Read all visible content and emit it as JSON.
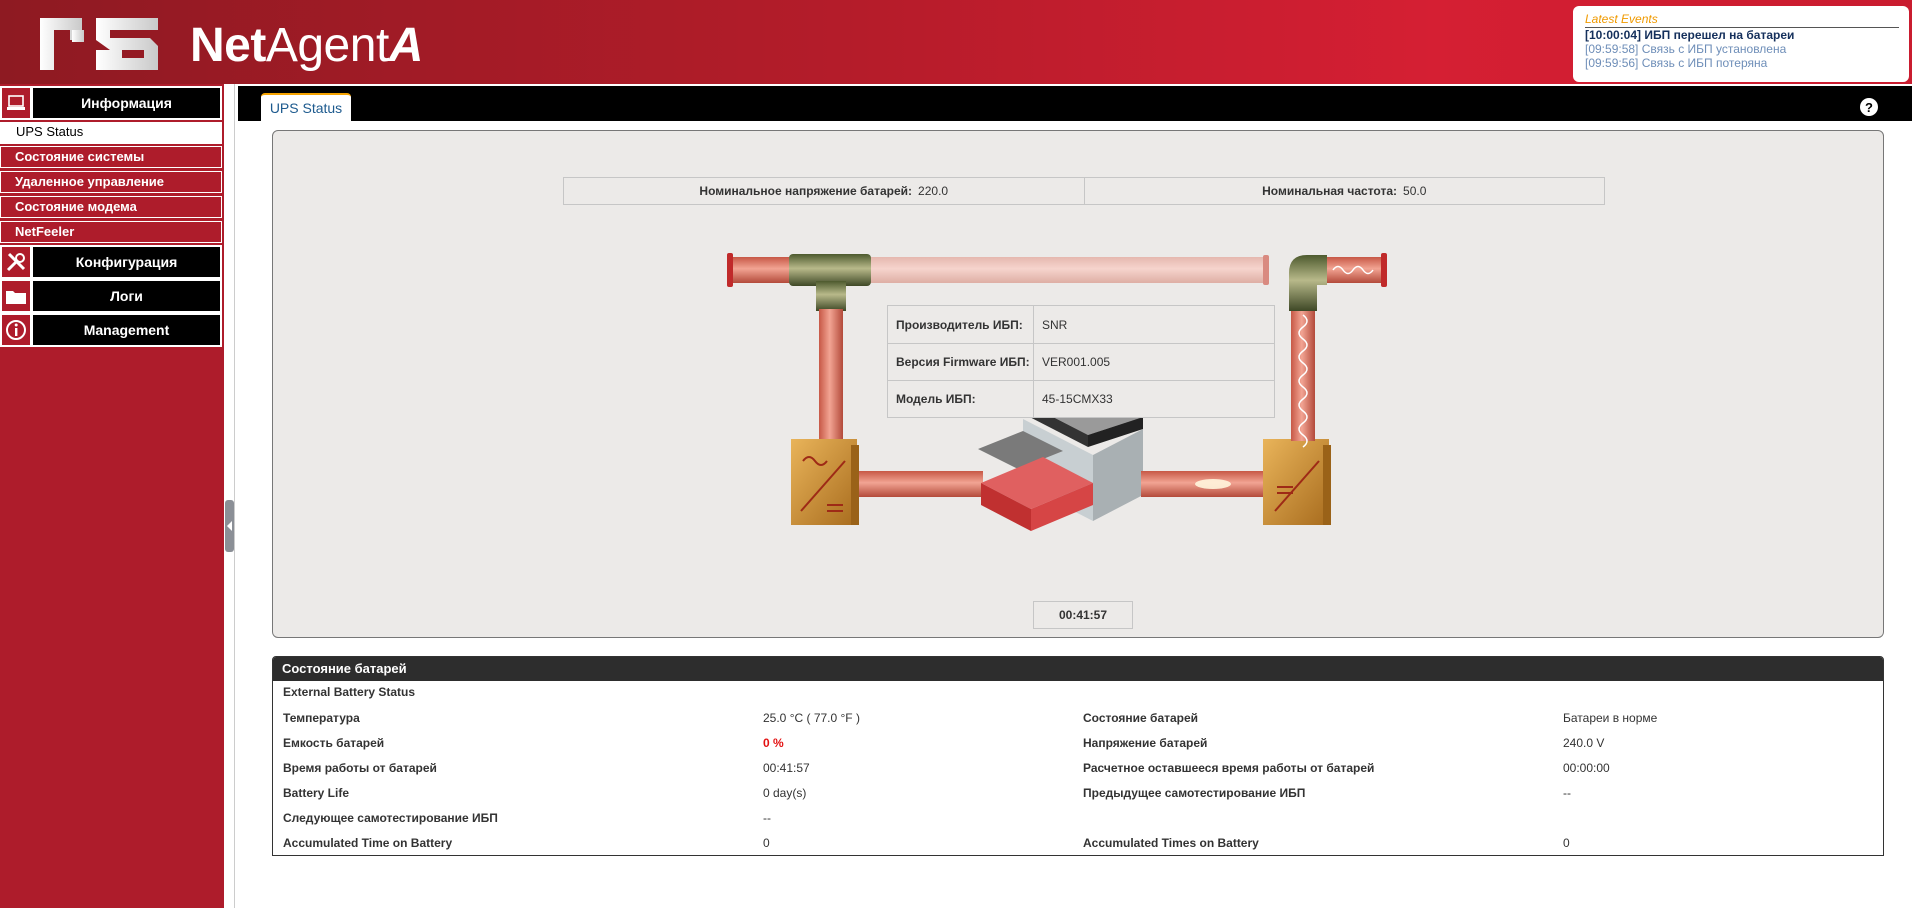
{
  "header": {
    "brand_net": "Net",
    "brand_agent": "Agent",
    "brand_a": "A"
  },
  "events": {
    "title": "Latest Events",
    "items": [
      "[10:00:04] ИБП перешел на батареи",
      "[09:59:58] Связь с ИБП установлена",
      "[09:59:56] Связь с ИБП потеряна"
    ]
  },
  "sidebar": {
    "info_label": "Информация",
    "ups_status": "UPS Status",
    "system_state": "Состояние системы",
    "remote": "Удаленное управление",
    "modem": "Состояние модема",
    "netfeeler": "NetFeeler",
    "config_label": "Конфигурация",
    "logs_label": "Логи",
    "management_label": "Management"
  },
  "tab": {
    "label": "UPS Status"
  },
  "help": "?",
  "nominal": {
    "voltage_label": "Номинальное напряжение батарей:",
    "voltage_value": "220.0",
    "freq_label": "Номинальная частота:",
    "freq_value": "50.0"
  },
  "ups_info": {
    "vendor_label": "Производитель ИБП:",
    "vendor_value": "SNR",
    "fw_label": "Версия Firmware ИБП:",
    "fw_value": "VER001.005",
    "model_label": "Модель ИБП:",
    "model_value": "45-15CMX33"
  },
  "timer": "00:41:57",
  "battery": {
    "title": "Состояние батарей",
    "subtitle": "External Battery Status",
    "rows": [
      [
        "Температура",
        "25.0 °C ( 77.0 °F )",
        "Состояние батарей",
        "Батареи в норме"
      ],
      [
        "Емкость батарей",
        "0 %",
        "Напряжение батарей",
        "240.0 V"
      ],
      [
        "Время работы от батарей",
        "00:41:57",
        "Расчетное оставшееся время работы от батарей",
        "00:00:00"
      ],
      [
        "Battery Life",
        "0 day(s)",
        "Предыдущее самотестирование ИБП",
        "--"
      ],
      [
        "Следующее самотестирование ИБП",
        "--",
        "",
        ""
      ],
      [
        "Accumulated Time on Battery",
        "0",
        "Accumulated Times on Battery",
        "0"
      ]
    ]
  },
  "colors": {
    "brand_red": "#ae1c2b",
    "event_title": "#f09a00",
    "alert": "#e31111"
  }
}
